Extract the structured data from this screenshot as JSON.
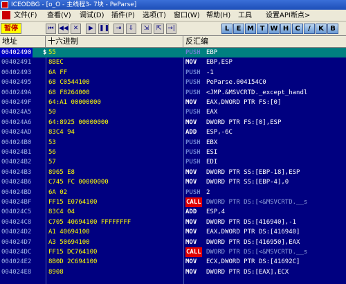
{
  "window": {
    "title": "ICEODBG - [o_O - 主线程3- 7块 - PeParse]"
  },
  "menu": [
    "文件(F)",
    "查看(V)",
    "调试(D)",
    "插件(P)",
    "选项(T)",
    "窗口(W)",
    "帮助(H)",
    "工具",
    "设置API断点>"
  ],
  "toolbar": {
    "pause_label": "暂停",
    "buttons": [
      "⏮",
      "◀◀",
      "✕",
      "▶",
      "❚❚",
      "⇥",
      "⇩",
      "⇲",
      "⇱",
      "→|"
    ],
    "letters": [
      "L",
      "E",
      "M",
      "T",
      "W",
      "H",
      "C",
      "/",
      "K",
      "B"
    ]
  },
  "columns": {
    "address": "地址",
    "hex": "十六进制",
    "disasm": "反汇编"
  },
  "colors": {
    "background": "#000080",
    "selected_row": "#008080",
    "hex_text": "#ffff00",
    "call_bg": "#e00000"
  },
  "rows": [
    {
      "addr": "00402490",
      "hex": "55",
      "mn": "PUSH",
      "ops": "EBP",
      "sel": true,
      "arrow": "$"
    },
    {
      "addr": "00402491",
      "hex": "8BEC",
      "mn": "MOV",
      "ops": "EBP,ESP"
    },
    {
      "addr": "00402493",
      "hex": "6A FF",
      "mn": "PUSH",
      "ops": "-1"
    },
    {
      "addr": "00402495",
      "hex": "68 C0544100",
      "mn": "PUSH",
      "ops": "PeParse.004154C0"
    },
    {
      "addr": "0040249A",
      "hex": "68 F8264000",
      "mn": "PUSH",
      "ops": "<JMP.&MSVCRTD._except_handl"
    },
    {
      "addr": "0040249F",
      "hex": "64:A1 00000000",
      "mn": "MOV",
      "ops": "EAX,DWORD PTR FS:[0]"
    },
    {
      "addr": "004024A5",
      "hex": "50",
      "mn": "PUSH",
      "ops": "EAX"
    },
    {
      "addr": "004024A6",
      "hex": "64:8925 00000000",
      "mn": "MOV",
      "ops": "DWORD PTR FS:[0],ESP"
    },
    {
      "addr": "004024AD",
      "hex": "83C4 94",
      "mn": "ADD",
      "ops": "ESP,-6C"
    },
    {
      "addr": "004024B0",
      "hex": "53",
      "mn": "PUSH",
      "ops": "EBX"
    },
    {
      "addr": "004024B1",
      "hex": "56",
      "mn": "PUSH",
      "ops": "ESI"
    },
    {
      "addr": "004024B2",
      "hex": "57",
      "mn": "PUSH",
      "ops": "EDI"
    },
    {
      "addr": "004024B3",
      "hex": "8965 E8",
      "mn": "MOV",
      "ops": "DWORD PTR SS:[EBP-18],ESP"
    },
    {
      "addr": "004024B6",
      "hex": "C745 FC 00000000",
      "mn": "MOV",
      "ops": "DWORD PTR SS:[EBP-4],0"
    },
    {
      "addr": "004024BD",
      "hex": "6A 02",
      "mn": "PUSH",
      "ops": "2"
    },
    {
      "addr": "004024BF",
      "hex": "FF15 E0764100",
      "mn": "CALL",
      "ops": "DWORD PTR DS:[<&MSVCRTD.__s"
    },
    {
      "addr": "004024C5",
      "hex": "83C4 04",
      "mn": "ADD",
      "ops": "ESP,4"
    },
    {
      "addr": "004024C8",
      "hex": "C705 40694100 FFFFFFFF",
      "mn": "MOV",
      "ops": "DWORD PTR DS:[416940],-1"
    },
    {
      "addr": "004024D2",
      "hex": "A1 40694100",
      "mn": "MOV",
      "ops": "EAX,DWORD PTR DS:[416940]"
    },
    {
      "addr": "004024D7",
      "hex": "A3 50694100",
      "mn": "MOV",
      "ops": "DWORD PTR DS:[416950],EAX"
    },
    {
      "addr": "004024DC",
      "hex": "FF15 DC764100",
      "mn": "CALL",
      "ops": "DWORD PTR DS:[<&MSVCRTD.__s"
    },
    {
      "addr": "004024E2",
      "hex": "8B0D 2C694100",
      "mn": "MOV",
      "ops": "ECX,DWORD PTR DS:[41692C]"
    },
    {
      "addr": "004024E8",
      "hex": "8908",
      "mn": "MOV",
      "ops": "DWORD PTR DS:[EAX],ECX"
    }
  ]
}
